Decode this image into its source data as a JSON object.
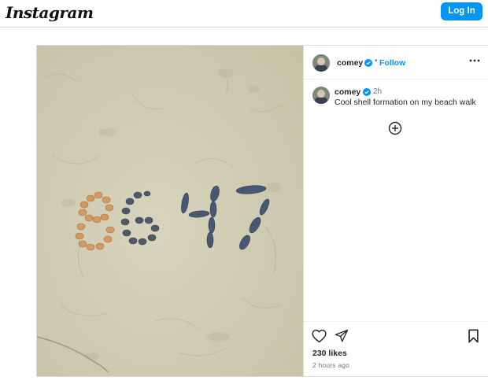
{
  "app": {
    "logo_text": "Instagram",
    "login_label": "Log In"
  },
  "post": {
    "author": {
      "username": "comey",
      "verified": true,
      "follow_label": "Follow",
      "separator": "•"
    },
    "caption": {
      "username": "comey",
      "time": "2h",
      "text": "Cool shell formation on my beach walk"
    },
    "likes": "230 likes",
    "posted_ago": "2 hours ago",
    "icons": [
      "verified-badge-icon",
      "more-options-icon",
      "load-more-comments-icon",
      "heart-icon",
      "share-icon",
      "bookmark-icon"
    ]
  },
  "colors": {
    "accent": "#0095f6",
    "sand": "#d1cdb6",
    "text": "#262626",
    "muted": "#737373"
  }
}
